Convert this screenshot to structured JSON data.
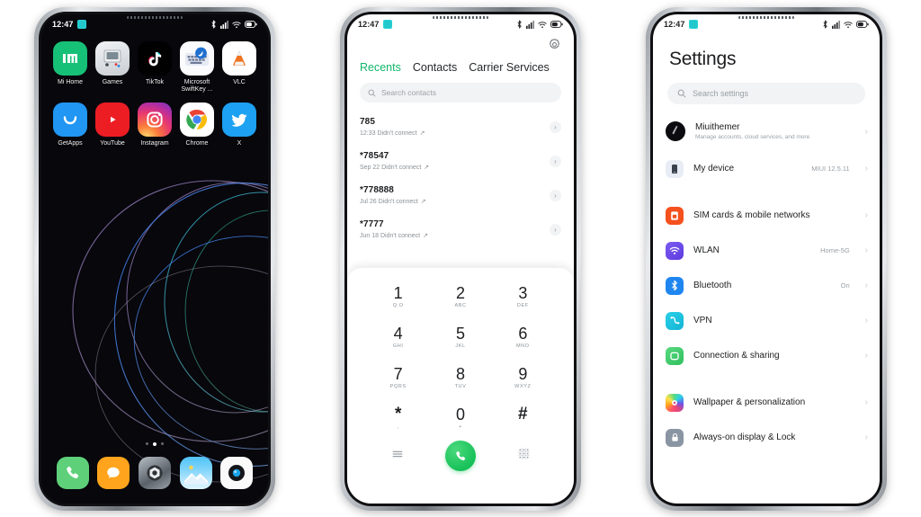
{
  "phone1": {
    "name": "home-screen",
    "status": {
      "time": "12:47",
      "icons": [
        "bluetooth-icon",
        "signal-icon",
        "wifi-icon",
        "battery-icon"
      ]
    },
    "apps_row1": [
      {
        "label": "Mi Home",
        "icon": "mi-home-icon"
      },
      {
        "label": "Games",
        "icon": "games-icon"
      },
      {
        "label": "TikTok",
        "icon": "tiktok-icon"
      },
      {
        "label": "Microsoft SwiftKey ...",
        "icon": "swiftkey-icon"
      },
      {
        "label": "VLC",
        "icon": "vlc-icon"
      }
    ],
    "apps_row2": [
      {
        "label": "GetApps",
        "icon": "getapps-icon"
      },
      {
        "label": "YouTube",
        "icon": "youtube-icon"
      },
      {
        "label": "Instagram",
        "icon": "instagram-icon"
      },
      {
        "label": "Chrome",
        "icon": "chrome-icon"
      },
      {
        "label": "X",
        "icon": "x-twitter-icon"
      }
    ],
    "dock": [
      {
        "label": "Phone",
        "icon": "phone-icon"
      },
      {
        "label": "Messages",
        "icon": "messages-icon"
      },
      {
        "label": "Settings",
        "icon": "settings-icon"
      },
      {
        "label": "Gallery",
        "icon": "gallery-icon"
      },
      {
        "label": "Camera",
        "icon": "camera-icon"
      }
    ],
    "page_dots": {
      "count": 3,
      "active_index": 1
    }
  },
  "phone2": {
    "name": "dialer-screen",
    "status": {
      "time": "12:47",
      "icons": [
        "bluetooth-icon",
        "signal-icon",
        "wifi-icon",
        "battery-icon"
      ]
    },
    "header": {
      "settings_icon": "gear-icon"
    },
    "tabs": [
      {
        "label": "Recents",
        "active": true
      },
      {
        "label": "Contacts",
        "active": false
      },
      {
        "label": "Carrier Services",
        "active": false
      }
    ],
    "search": {
      "placeholder": "Search contacts",
      "icon": "search-icon"
    },
    "calls": [
      {
        "number": "785",
        "detail": "12:33 Didn't connect",
        "arrow": "↗"
      },
      {
        "number": "*78547",
        "detail": "Sep 22 Didn't connect",
        "arrow": "↗"
      },
      {
        "number": "*778888",
        "detail": "Jul 26 Didn't connect",
        "arrow": "↗"
      },
      {
        "number": "*7777",
        "detail": "Jun 18 Didn't connect",
        "arrow": "↗"
      }
    ],
    "keypad": [
      {
        "num": "1",
        "sub": "Q.O"
      },
      {
        "num": "2",
        "sub": "ABC"
      },
      {
        "num": "3",
        "sub": "DEF"
      },
      {
        "num": "4",
        "sub": "GHI"
      },
      {
        "num": "5",
        "sub": "JKL"
      },
      {
        "num": "6",
        "sub": "MNO"
      },
      {
        "num": "7",
        "sub": "PQRS"
      },
      {
        "num": "8",
        "sub": "TUV"
      },
      {
        "num": "9",
        "sub": "WXYZ"
      },
      {
        "num": "*",
        "sub": ","
      },
      {
        "num": "0",
        "sub": "+"
      },
      {
        "num": "#",
        "sub": ""
      }
    ],
    "actions": {
      "menu_icon": "hamburger-menu-icon",
      "call_icon": "call-handset-icon",
      "keypad_icon": "keypad-grid-icon"
    },
    "accent": "#12b76a"
  },
  "phone3": {
    "name": "settings-screen",
    "status": {
      "time": "12:47",
      "icons": [
        "bluetooth-icon",
        "signal-icon",
        "wifi-icon",
        "battery-icon"
      ]
    },
    "title": "Settings",
    "search": {
      "placeholder": "Search settings",
      "icon": "search-icon"
    },
    "account": {
      "name": "Miuithemer",
      "desc": "Manage accounts, cloud services, and more",
      "icon": "account-avatar"
    },
    "device": {
      "label": "My device",
      "value": "MIUI 12.5.11",
      "icon": "device-phone-icon"
    },
    "items": [
      {
        "label": "SIM cards & mobile networks",
        "value": "",
        "icon": "sim-card-icon",
        "color": "#f4511e"
      },
      {
        "label": "WLAN",
        "value": "Home-5G",
        "icon": "wifi-icon",
        "color": "#6d53e8"
      },
      {
        "label": "Bluetooth",
        "value": "On",
        "icon": "bluetooth-icon",
        "color": "#1f86f0"
      },
      {
        "label": "VPN",
        "value": "",
        "icon": "vpn-icon",
        "color": "#19bcd8"
      },
      {
        "label": "Connection & sharing",
        "value": "",
        "icon": "connection-sharing-icon",
        "color": "#3cc96a"
      }
    ],
    "items2": [
      {
        "label": "Wallpaper & personalization",
        "value": "",
        "icon": "wallpaper-icon",
        "color": "#e0457b"
      },
      {
        "label": "Always-on display & Lock",
        "value": "",
        "icon": "lock-icon",
        "color": "#7b8794"
      }
    ],
    "chevron": "›"
  }
}
